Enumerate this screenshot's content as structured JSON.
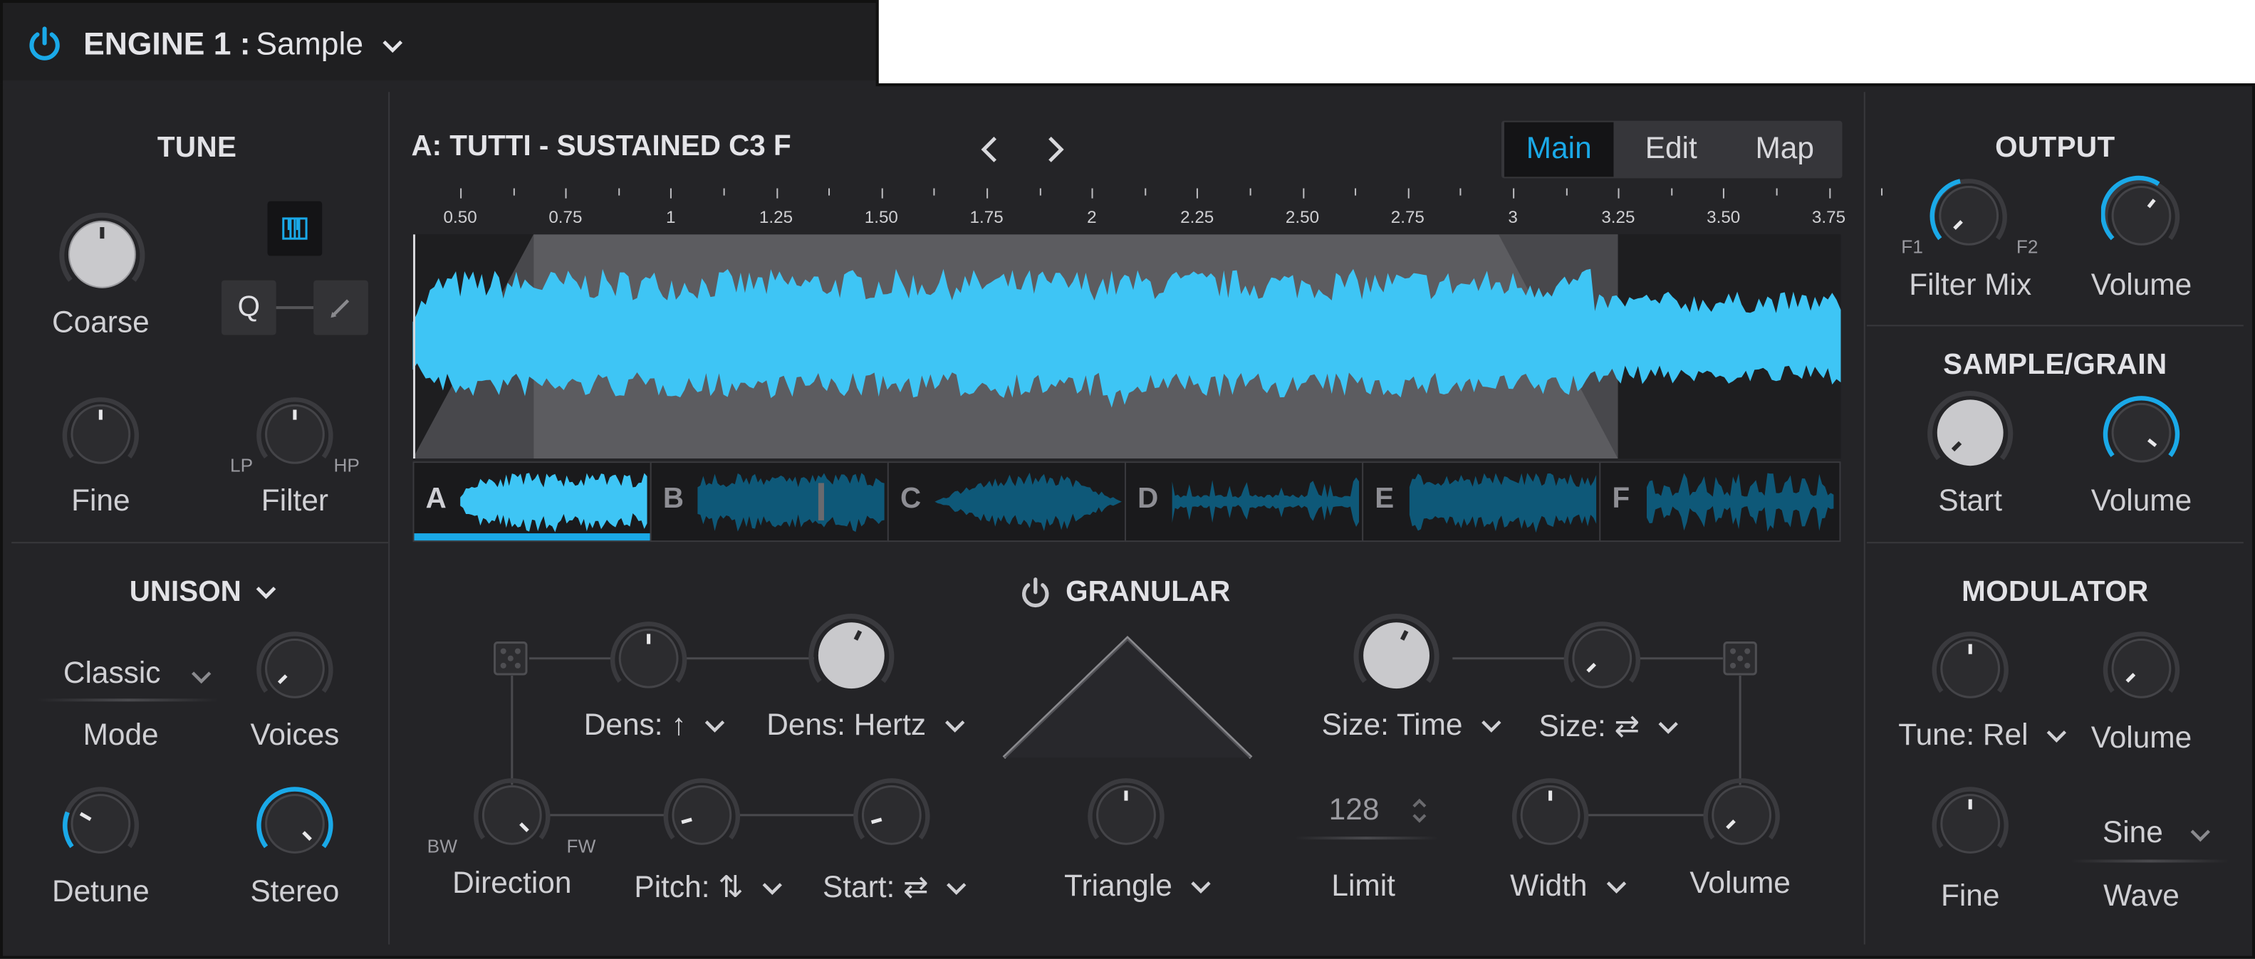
{
  "engine": {
    "label": "ENGINE 1 :",
    "type": "Sample"
  },
  "tune": {
    "title": "TUNE",
    "coarse": "Coarse",
    "fine": "Fine",
    "filter": "Filter",
    "lp": "LP",
    "hp": "HP",
    "q_button": "Q"
  },
  "unison": {
    "title": "UNISON",
    "mode_value": "Classic",
    "mode": "Mode",
    "voices": "Voices",
    "detune": "Detune",
    "stereo": "Stereo"
  },
  "sample": {
    "name": "A: TUTTI - SUSTAINED C3 F",
    "tabs": [
      "Main",
      "Edit",
      "Map"
    ],
    "active_tab": "Main",
    "ruler": [
      "0.50",
      "0.75",
      "1",
      "1.25",
      "1.50",
      "1.75",
      "2",
      "2.25",
      "2.50",
      "2.75",
      "3",
      "3.25",
      "3.50",
      "3.75"
    ],
    "slots": [
      "A",
      "B",
      "C",
      "D",
      "E",
      "F"
    ],
    "active_slot": "A"
  },
  "granular": {
    "title": "GRANULAR",
    "dens_mod": "Dens: ↑",
    "dens_hertz": "Dens: Hertz",
    "direction": "Direction",
    "bw": "BW",
    "fw": "FW",
    "pitch": "Pitch: ⇅",
    "start": "Start: ⇄",
    "envelope": "Triangle",
    "size_time": "Size: Time",
    "size_mod": "Size: ⇄",
    "limit_value": "128",
    "limit": "Limit",
    "width": "Width",
    "volume": "Volume"
  },
  "output": {
    "title": "OUTPUT",
    "filter_mix": "Filter Mix",
    "f1": "F1",
    "f2": "F2",
    "volume": "Volume"
  },
  "sample_grain": {
    "title": "SAMPLE/GRAIN",
    "start": "Start",
    "volume": "Volume"
  },
  "modulator": {
    "title": "MODULATOR",
    "tune_rel": "Tune: Rel",
    "volume": "Volume",
    "fine": "Fine",
    "wave_value": "Sine",
    "wave": "Wave"
  },
  "colors": {
    "accent": "#1aa9e8",
    "waveform": "#3ec5f5",
    "panel": "#242427",
    "background": "#1c1c1e"
  },
  "icons": [
    "power-icon",
    "keyboard-icon",
    "pencil-icon",
    "dice-icon",
    "chevron-down-icon",
    "chevron-left-icon",
    "chevron-right-icon",
    "stepper-icon"
  ]
}
